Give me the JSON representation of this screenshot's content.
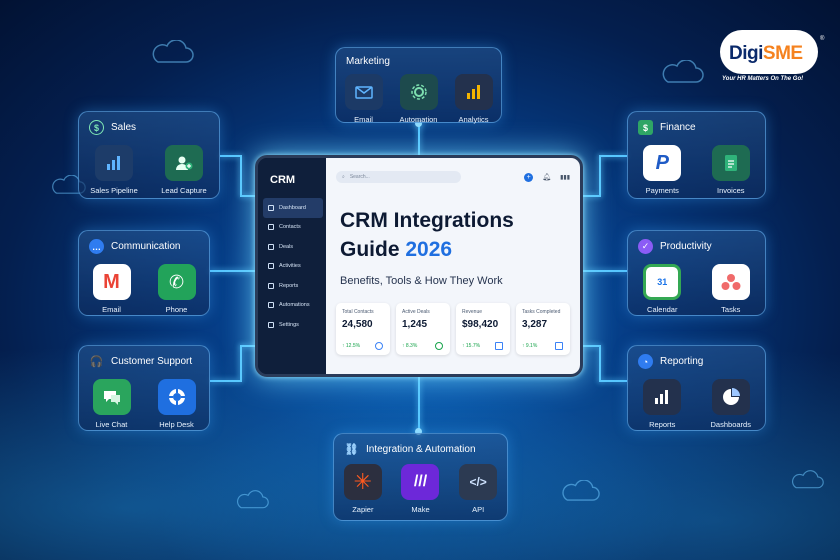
{
  "brand": {
    "logo_left": "Digi",
    "logo_right": "SME",
    "registered": "®",
    "tagline": "Your HR Matters On The Go!"
  },
  "monitor": {
    "app_name": "CRM",
    "nav": [
      "Dashboard",
      "Contacts",
      "Deals",
      "Activities",
      "Reports",
      "Automations",
      "Settings"
    ],
    "search_placeholder": "Search...",
    "headline_line1": "CRM Integrations",
    "headline_line2": "Guide",
    "headline_year": "2026",
    "subheadline": "Benefits, Tools & How They Work",
    "stats": [
      {
        "label": "Total Contacts",
        "value": "24,580",
        "change": "↑ 12.5%"
      },
      {
        "label": "Active Deals",
        "value": "1,245",
        "change": "↑ 8.3%"
      },
      {
        "label": "Revenue",
        "value": "$98,420",
        "change": "↑ 15.7%"
      },
      {
        "label": "Tasks Completed",
        "value": "3,287",
        "change": "↑ 9.1%"
      }
    ]
  },
  "categories": {
    "marketing": {
      "title": "Marketing",
      "items": [
        "Email",
        "Automation",
        "Analytics"
      ]
    },
    "sales": {
      "title": "Sales",
      "items": [
        "Sales Pipeline",
        "Lead Capture"
      ]
    },
    "finance": {
      "title": "Finance",
      "items": [
        "Payments",
        "Invoices"
      ]
    },
    "communication": {
      "title": "Communication",
      "items": [
        "Email",
        "Phone"
      ]
    },
    "productivity": {
      "title": "Productivity",
      "items": [
        "Calendar",
        "Tasks"
      ],
      "calendar_day": "31"
    },
    "support": {
      "title": "Customer Support",
      "items": [
        "Live Chat",
        "Help Desk"
      ]
    },
    "reporting": {
      "title": "Reporting",
      "items": [
        "Reports",
        "Dashboards"
      ]
    },
    "integration": {
      "title": "Integration & Automation",
      "items": [
        "Zapier",
        "Make",
        "API"
      ]
    }
  },
  "colors": {
    "accent": "#1f6fe0",
    "glow": "#59c8ff",
    "brand_orange": "#f5821f",
    "brand_navy": "#0b2a6b"
  }
}
